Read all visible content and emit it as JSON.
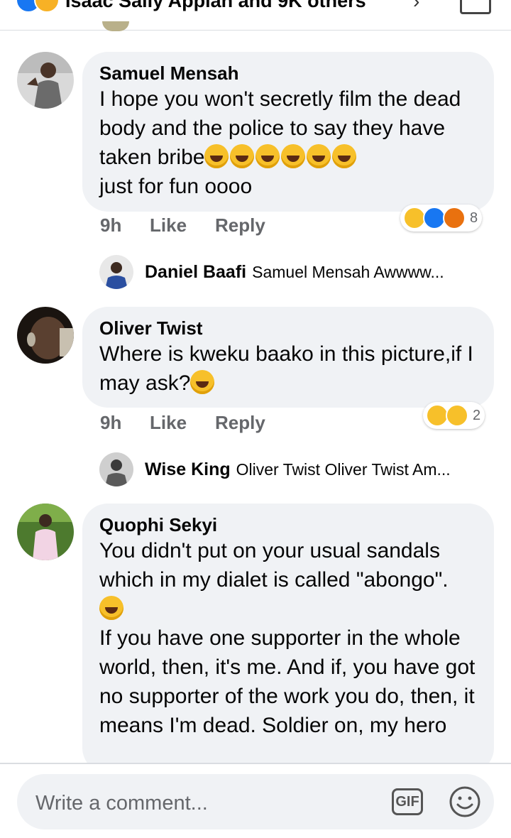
{
  "header": {
    "reactors_text": "Isaac Sally Appiah and 9K others",
    "chevron": "›"
  },
  "comments": [
    {
      "author": "Samuel Mensah",
      "text_before_emoji": "I hope you won't secretly film the dead body and the police to say they have taken bribe",
      "text_after_emoji": "just for fun oooo",
      "emojis": [
        "rolling-laughing-emoji",
        "rolling-laughing-emoji",
        "rolling-laughing-emoji",
        "joy-emoji",
        "joy-emoji",
        "joy-emoji"
      ],
      "time": "9h",
      "like_label": "Like",
      "reply_label": "Reply",
      "reaction_icons": [
        "haha-icon",
        "like-icon",
        "angry-icon"
      ],
      "reaction_count": "8",
      "reply_preview": {
        "name": "Daniel Baafi",
        "text": "Samuel Mensah Awwww..."
      }
    },
    {
      "author": "Oliver Twist",
      "text": "Where is kweku baako in this picture,if I may ask?",
      "emojis": [
        "thinking-emoji"
      ],
      "time": "9h",
      "like_label": "Like",
      "reply_label": "Reply",
      "reaction_icons": [
        "haha-icon",
        "wow-icon"
      ],
      "reaction_count": "2",
      "reply_preview": {
        "name": "Wise King",
        "text": "Oliver Twist Oliver Twist Am..."
      }
    },
    {
      "author": "Quophi Sekyi",
      "text_line1": "You didn't put on your usual sandals which in my dialet is called \"abongo\".",
      "emojis": [
        "joy-emoji"
      ],
      "text_line2": "If you have one supporter in the whole world, then, it's me. And if, you have got no supporter of the work you do, then, it means I'm dead. Soldier on, my hero"
    }
  ],
  "composer": {
    "placeholder": "Write a comment...",
    "gif_label": "GIF",
    "emoji_icon": "smiley-icon"
  },
  "colors": {
    "bubble": "#f0f2f5",
    "meta": "#65676b",
    "like_blue": "#1877f2",
    "emoji_yellow": "#f7c02a"
  }
}
